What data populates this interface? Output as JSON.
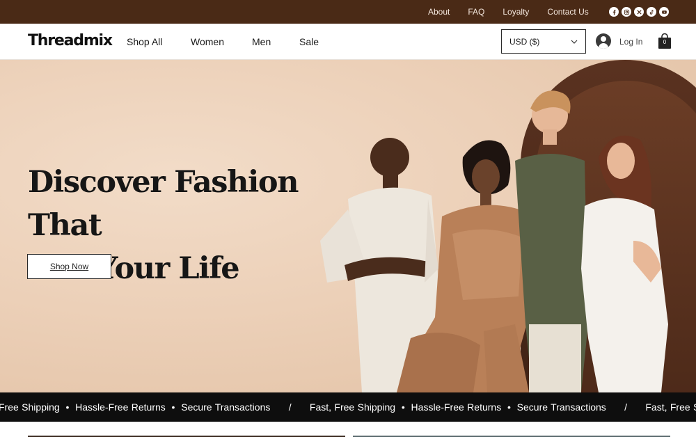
{
  "topbar": {
    "links": [
      "About",
      "FAQ",
      "Loyalty",
      "Contact Us"
    ],
    "social_icons": [
      "facebook-icon",
      "instagram-icon",
      "x-icon",
      "tiktok-icon",
      "youtube-icon"
    ]
  },
  "header": {
    "logo": "Threadmix",
    "nav": [
      "Shop All",
      "Women",
      "Men",
      "Sale"
    ],
    "currency": "USD ($)",
    "login": "Log In",
    "cart_count": "0"
  },
  "hero": {
    "title_line1": "Discover Fashion That",
    "title_line2": "Fits Your Life",
    "cta": "Shop Now"
  },
  "ticker": {
    "text": "Free Shipping  •  Hassle-Free Returns  •  Secure Transactions      /      Fast, Free Shipping  •  Hassle-Free Returns  •  Secure Transactions      /      Fast, Free Shipping"
  },
  "colors": {
    "topbar_bg": "#4a2a16",
    "hero_bg": "#ecd0b8",
    "ticker_bg": "#0e0e0e"
  }
}
